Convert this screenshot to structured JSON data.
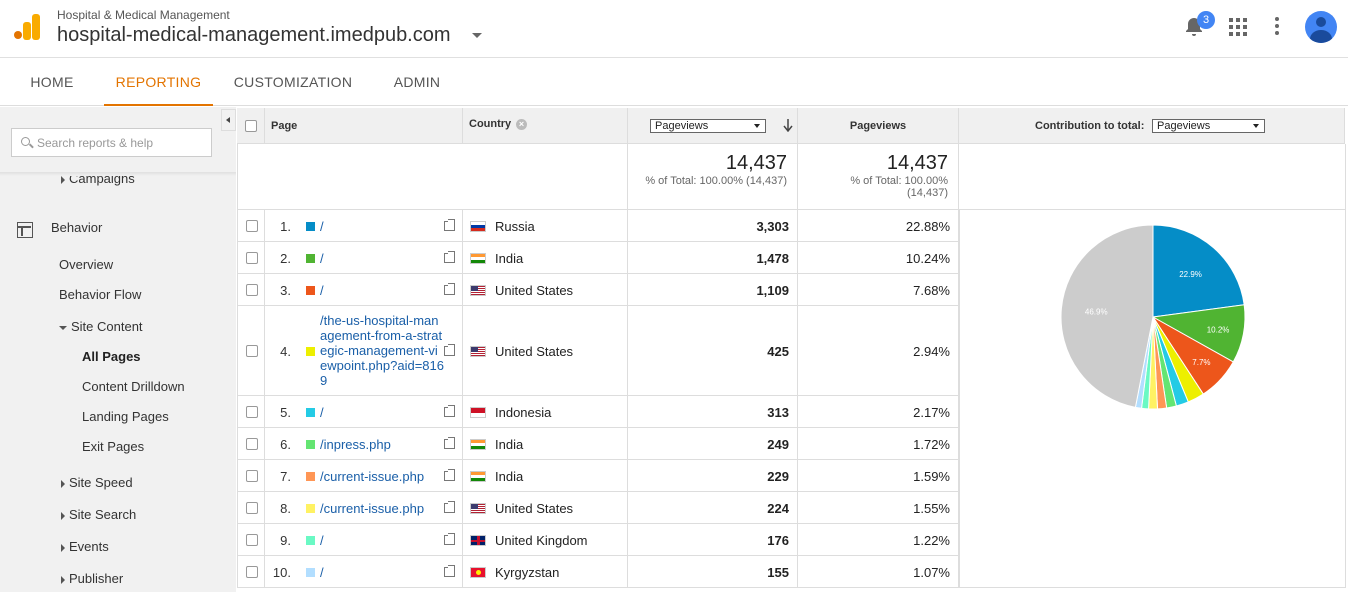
{
  "header": {
    "account": "Hospital & Medical Management",
    "property": "hospital-medical-management.imedpub.com",
    "notification_count": "3"
  },
  "nav": {
    "tabs": [
      {
        "label": "HOME",
        "active": false
      },
      {
        "label": "REPORTING",
        "active": true
      },
      {
        "label": "CUSTOMIZATION",
        "active": false
      },
      {
        "label": "ADMIN",
        "active": false
      }
    ]
  },
  "sidebar": {
    "search_placeholder": "Search reports & help",
    "campaigns": "Campaigns",
    "behavior": "Behavior",
    "overview": "Overview",
    "behavior_flow": "Behavior Flow",
    "site_content": "Site Content",
    "all_pages": "All Pages",
    "content_drilldown": "Content Drilldown",
    "landing_pages": "Landing Pages",
    "exit_pages": "Exit Pages",
    "site_speed": "Site Speed",
    "site_search": "Site Search",
    "events": "Events",
    "publisher": "Publisher"
  },
  "table": {
    "col_page": "Page",
    "col_country": "Country",
    "metric_select": "Pageviews",
    "col_pageviews": "Pageviews",
    "contribution_label": "Contribution to total:",
    "contribution_select": "Pageviews",
    "total_value": "14,437",
    "total_sub": "% of Total: 100.00% (14,437)",
    "total_value2": "14,437",
    "total_sub2_a": "% of Total: 100.00%",
    "total_sub2_b": "(14,437)",
    "rows": [
      {
        "rank": "1.",
        "color": "#058dc7",
        "page": "/",
        "country": "Russia",
        "flag": "russia",
        "pageviews": "3,303",
        "pct": "22.88%"
      },
      {
        "rank": "2.",
        "color": "#50b432",
        "page": "/",
        "country": "India",
        "flag": "india",
        "pageviews": "1,478",
        "pct": "10.24%"
      },
      {
        "rank": "3.",
        "color": "#ed561b",
        "page": "/",
        "country": "United States",
        "flag": "us",
        "pageviews": "1,109",
        "pct": "7.68%"
      },
      {
        "rank": "4.",
        "color": "#edef00",
        "page": "/the-us-hospital-management-from-a-strategic-management-viewpoint.php?aid=8169",
        "page_lines": [
          "/the-us-hospital-man",
          "agement-from-a-strat",
          "egic-management-vi",
          "ewpoint.php?aid=816",
          "9"
        ],
        "country": "United States",
        "flag": "us",
        "pageviews": "425",
        "pct": "2.94%"
      },
      {
        "rank": "5.",
        "color": "#24cbe5",
        "page": "/",
        "country": "Indonesia",
        "flag": "indonesia",
        "pageviews": "313",
        "pct": "2.17%"
      },
      {
        "rank": "6.",
        "color": "#64e572",
        "page": "/inpress.php",
        "country": "India",
        "flag": "india",
        "pageviews": "249",
        "pct": "1.72%"
      },
      {
        "rank": "7.",
        "color": "#ff9655",
        "page": "/current-issue.php",
        "country": "India",
        "flag": "india",
        "pageviews": "229",
        "pct": "1.59%"
      },
      {
        "rank": "8.",
        "color": "#fff263",
        "page": "/current-issue.php",
        "country": "United States",
        "flag": "us",
        "pageviews": "224",
        "pct": "1.55%"
      },
      {
        "rank": "9.",
        "color": "#6af9c4",
        "page": "/",
        "country": "United Kingdom",
        "flag": "uk",
        "pageviews": "176",
        "pct": "1.22%"
      },
      {
        "rank": "10.",
        "color": "#b2deff",
        "page": "/",
        "country": "Kyrgyzstan",
        "flag": "kyrgyzstan",
        "pageviews": "155",
        "pct": "1.07%"
      }
    ]
  },
  "chart_data": {
    "type": "pie",
    "slices": [
      {
        "label": "22.9%",
        "value": 22.88,
        "color": "#058dc7"
      },
      {
        "label": "10.2%",
        "value": 10.24,
        "color": "#50b432"
      },
      {
        "label": "7.7%",
        "value": 7.68,
        "color": "#ed561b"
      },
      {
        "label": "",
        "value": 2.94,
        "color": "#edef00"
      },
      {
        "label": "",
        "value": 2.17,
        "color": "#24cbe5"
      },
      {
        "label": "",
        "value": 1.72,
        "color": "#64e572"
      },
      {
        "label": "",
        "value": 1.59,
        "color": "#ff9655"
      },
      {
        "label": "",
        "value": 1.55,
        "color": "#fff263"
      },
      {
        "label": "",
        "value": 1.22,
        "color": "#6af9c4"
      },
      {
        "label": "",
        "value": 1.07,
        "color": "#b2deff"
      },
      {
        "label": "46.9%",
        "value": 46.94,
        "color": "#cccccc"
      }
    ]
  }
}
